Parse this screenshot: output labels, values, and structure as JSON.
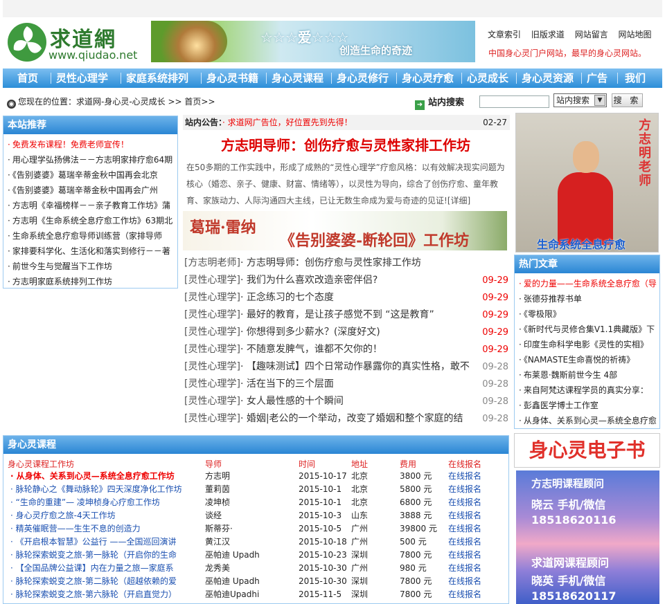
{
  "header": {
    "logo_text": "求道網",
    "logo_url": "www.qiudao.net",
    "banner_stars": "☆☆☆爱☆☆☆",
    "banner_slogan": "创造生命的奇迹",
    "links": [
      "文章索引",
      "旧版求道",
      "网站留言",
      "网站地图"
    ],
    "tagline": "中国身心灵门户网站，最早的身心灵网站。"
  },
  "nav": [
    "首页",
    "灵性心理学",
    "家庭系统排列",
    "身心灵书籍",
    "身心灵课程",
    "身心灵修行",
    "身心灵疗愈",
    "心灵成长",
    "身心灵资源",
    "广告",
    "我们"
  ],
  "breadcrumb": {
    "text": "您现在的位置：求道网-身心灵-心灵成长 >> 首页>>"
  },
  "search": {
    "label": "站内搜索",
    "select_value": "站内搜索",
    "button": "搜 索"
  },
  "recommend": {
    "title": "本站推荐",
    "items": [
      {
        "text": "免费发布课程！免费老师宣传！",
        "highlight": true
      },
      {
        "text": "用心理学弘扬佛法－－方志明家排疗愈64期",
        "highlight": false
      },
      {
        "text": "《告别婆婆》葛瑞辛蒂金秋中国再会北京",
        "highlight": false
      },
      {
        "text": "《告别婆婆》葛瑞辛蒂金秋中国再会广州",
        "highlight": false
      },
      {
        "text": "方志明《幸福榜样－－亲子教育工作坊》蒲",
        "highlight": false
      },
      {
        "text": "方志明《生命系统全息疗愈工作坊》63期北",
        "highlight": false
      },
      {
        "text": "生命系统全息疗愈导师训练营（家排导师",
        "highlight": false
      },
      {
        "text": "家排要科学化、生活化和落实到修行－－著",
        "highlight": false
      },
      {
        "text": "前世今生与觉醒当下工作坊",
        "highlight": false
      },
      {
        "text": "方志明家庭系统排列工作坊",
        "highlight": false
      }
    ]
  },
  "notice": {
    "label": "站内公告：",
    "text": "· 求道网广告位，好位置先到先得！",
    "date": "02-27"
  },
  "headline": {
    "title": "方志明导师：创伤疗愈与灵性家排工作坊",
    "summary": "在50多期的工作实践中，形成了成熟的“灵性心理学”疗愈风格：以有效解决现实问题为核心（婚恋、亲子、健康、财富、情绪等），以灵性为导向，综合了创伤疗愈、童年教育、家族动力、人际沟通四大主线，已让无数生命成为爱与奇迹的见证![详细]"
  },
  "ad": {
    "line1": "葛瑞·雷纳",
    "line2": "《告别婆婆-断轮回》工作坊"
  },
  "articles": [
    {
      "cat": "[方志明老师]",
      "title": "· 方志明导师：创伤疗愈与灵性家排工作坊",
      "date": "",
      "hot": false
    },
    {
      "cat": "[灵性心理学]",
      "title": "· 我们为什么喜欢改造亲密伴侣?",
      "date": "09-29",
      "hot": true
    },
    {
      "cat": "[灵性心理学]",
      "title": "· 正念练习的七个态度",
      "date": "09-29",
      "hot": true
    },
    {
      "cat": "[灵性心理学]",
      "title": "· 最好的教育，是让孩子感觉不到 “这是教育”",
      "date": "09-29",
      "hot": true
    },
    {
      "cat": "[灵性心理学]",
      "title": "· 你想得到多少薪水？(深度好文)",
      "date": "09-29",
      "hot": true
    },
    {
      "cat": "[灵性心理学]",
      "title": "· 不随意发脾气，谁都不欠你的！",
      "date": "09-29",
      "hot": true
    },
    {
      "cat": "[灵性心理学]",
      "title": "· 【趣味测试】四个日常动作暴露你的真实性格，敢不",
      "date": "09-28",
      "hot": false
    },
    {
      "cat": "[灵性心理学]",
      "title": "· 活在当下的三个层面",
      "date": "09-28",
      "hot": false
    },
    {
      "cat": "[灵性心理学]",
      "title": "· 女人最性感的十个瞬间",
      "date": "09-28",
      "hot": false
    },
    {
      "cat": "[灵性心理学]",
      "title": "· 婚姻|老公的一个举动，改变了婚姻和整个家庭的结",
      "date": "09-28",
      "hot": false
    }
  ],
  "photo": {
    "vertical": "方志明老师",
    "caption": "生命系统全息疗愈"
  },
  "hot": {
    "title": "热门文章",
    "items": [
      {
        "text": "爱的力量——生命系统全息疗愈（导",
        "highlight": true
      },
      {
        "text": "张德芬推荐书单",
        "highlight": false
      },
      {
        "text": "《零极限》",
        "highlight": false
      },
      {
        "text": "《新时代与灵修合集V1.1典藏版》下",
        "highlight": false
      },
      {
        "text": "印度生命科学电影《灵性的实相》",
        "highlight": false
      },
      {
        "text": "《NAMASTE生命喜悦的祈祷》",
        "highlight": false
      },
      {
        "text": "布莱恩·魏斯前世今生 4部",
        "highlight": false
      },
      {
        "text": "来自阿梵达课程学员的真实分享：",
        "highlight": false
      },
      {
        "text": "彭鑫医学博士工作室",
        "highlight": false
      },
      {
        "text": "从身体、关系到心灵—系统全息疗愈",
        "highlight": false
      }
    ]
  },
  "course": {
    "title": "身心灵课程",
    "headers": [
      "身心灵课程工作坊",
      "导师",
      "时间",
      "地址",
      "费用",
      "在线报名"
    ],
    "rows": [
      {
        "name": "· 从身体、关系到心灵—系统全息疗愈工作坊",
        "teacher": "方志明",
        "date": "2015-10-17",
        "city": "北京",
        "fee": "3800 元",
        "signup": "在线报名",
        "hot": true
      },
      {
        "name": "· 脉轮静心之《舞动脉轮》四天深度净化工作坊",
        "teacher": "董莉茵",
        "date": "2015-10-1",
        "city": "北京",
        "fee": "5800 元",
        "signup": "在线报名",
        "hot": false
      },
      {
        "name": "· “生命的重建”— 凌坤桢身心疗愈工作坊",
        "teacher": "凌坤桢",
        "date": "2015-10-1",
        "city": "北京",
        "fee": "6800 元",
        "signup": "在线报名",
        "hot": false
      },
      {
        "name": "· 身心灵疗愈之旅-4天工作坊",
        "teacher": "谈经",
        "date": "2015-10-3",
        "city": "山东",
        "fee": "3888 元",
        "signup": "在线报名",
        "hot": false
      },
      {
        "name": "· 精英催眠营——生生不息的创造力",
        "teacher": "斯蒂芬·",
        "date": "2015-10-5",
        "city": "广州",
        "fee": "39800 元",
        "signup": "在线报名",
        "hot": false
      },
      {
        "name": "· 《开启根本智慧》公益行 ——全国巡回演讲",
        "teacher": "黄江汉",
        "date": "2015-10-18",
        "city": "广州",
        "fee": "500 元",
        "signup": "在线报名",
        "hot": false
      },
      {
        "name": "· 脉轮探索蜕变之旅-第一脉轮（开启你的生命",
        "teacher": "巫帕迪 Upadh",
        "date": "2015-10-23",
        "city": "深圳",
        "fee": "7800 元",
        "signup": "在线报名",
        "hot": false
      },
      {
        "name": "· 【全国品牌公益课】内在力量之旅—家庭系",
        "teacher": "龙秀美",
        "date": "2015-10-30",
        "city": "广州",
        "fee": "980 元",
        "signup": "在线报名",
        "hot": false
      },
      {
        "name": "· 脉轮探索蜕变之旅-第二脉轮（超越依赖的爱",
        "teacher": "巫帕迪 Upadh",
        "date": "2015-10-30",
        "city": "深圳",
        "fee": "7800 元",
        "signup": "在线报名",
        "hot": false
      },
      {
        "name": "· 脉轮探索蜕变之旅-第六脉轮（开启直觉力）",
        "teacher": "巫帕迪Upadhi",
        "date": "2015-11-5",
        "city": "深圳",
        "fee": "7800 元",
        "signup": "在线报名",
        "hot": false
      }
    ]
  },
  "ebook": {
    "title": "身心灵电子书"
  },
  "advisor": {
    "title1": "方志明课程顾问",
    "name1": "晓云  手机/微信",
    "phone1": "18518620116",
    "title2": "求道网课程顾问",
    "name2": "晓英  手机/微信",
    "phone2": "18518620117"
  },
  "colors": {
    "nav_blue": "#2c8ed8",
    "accent_red": "#e00000",
    "link_blue": "#1a4fb0"
  }
}
